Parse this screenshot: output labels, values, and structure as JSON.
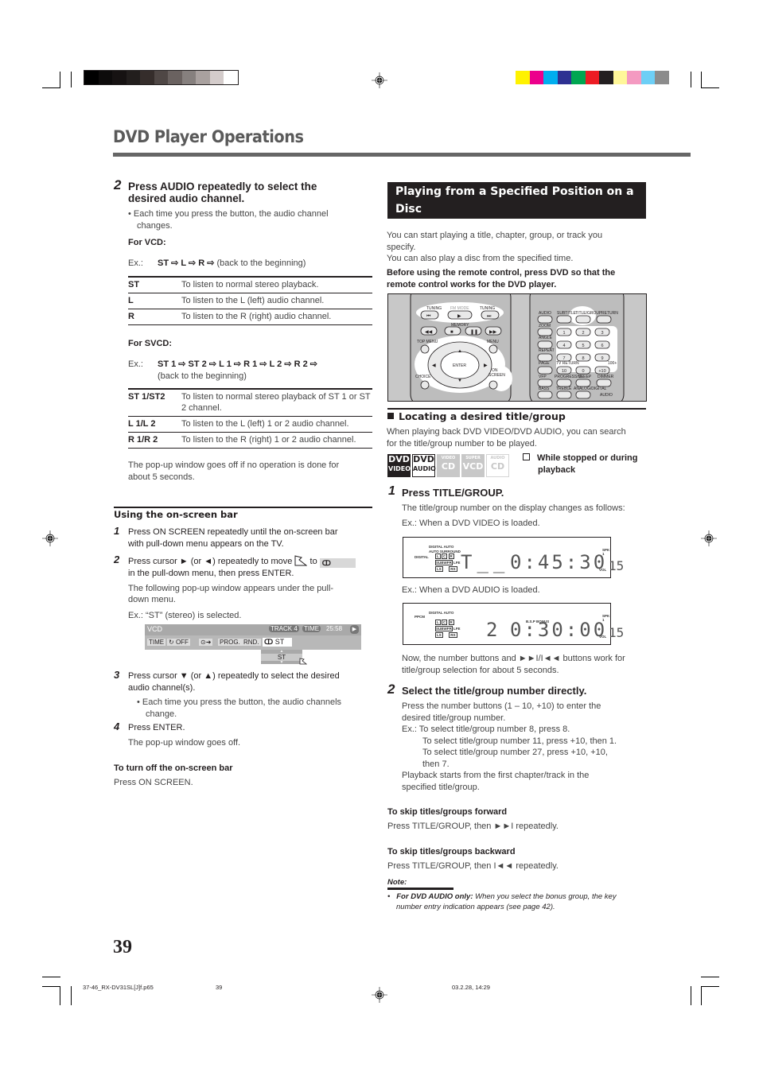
{
  "header": {
    "title": "DVD Player Operations",
    "gray_swatches": [
      "#000000",
      "#0d0b0b",
      "#161212",
      "#221e1d",
      "#352d2b",
      "#4f4745",
      "#6a6260",
      "#86807e",
      "#a9a19f",
      "#d4cccb",
      "#ffffff"
    ],
    "color_swatches": [
      "#fff200",
      "#ec008c",
      "#00aeef",
      "#2e3192",
      "#00a651",
      "#ed1c24",
      "#231f20",
      "#fff799",
      "#f49ac1",
      "#6dcff6",
      "#8c8c8c"
    ]
  },
  "left": {
    "step2": {
      "num": "2",
      "heading_line1": "Press AUDIO repeatedly to select the",
      "heading_line2": "desired audio channel.",
      "bullet_line1": "• Each time you press the button, the audio channel",
      "bullet_line2": "changes."
    },
    "vcd": {
      "label": "For VCD:",
      "ex_prefix": "Ex.:",
      "sequence": "ST ⇨ L ⇨ R ⇨",
      "sequence_tail": "(back to the beginning)",
      "rows": [
        {
          "key": "ST",
          "desc": "To listen to normal stereo playback."
        },
        {
          "key": "L",
          "desc": "To listen to the L (left) audio channel."
        },
        {
          "key": "R",
          "desc": "To listen to the R (right) audio channel."
        }
      ]
    },
    "svcd": {
      "label": "For SVCD:",
      "ex_prefix": "Ex.:",
      "sequence": "ST 1 ⇨ ST 2 ⇨ L 1 ⇨ R 1 ⇨ L 2 ⇨ R 2 ⇨",
      "sequence_tail": "(back to the beginning)",
      "rows": [
        {
          "key": "ST 1/ST2",
          "desc": "To listen to normal stereo playback of ST 1 or ST 2 channel."
        },
        {
          "key": "L 1/L 2",
          "desc": "To listen to the L (left) 1 or 2 audio channel."
        },
        {
          "key": "R 1/R 2",
          "desc": "To listen to the R (right) 1 or 2 audio channel."
        }
      ]
    },
    "popup_note_line1": "The pop-up window goes off if no operation is done for",
    "popup_note_line2": "about 5 seconds.",
    "onscreen": {
      "heading": "Using the on-screen bar",
      "s1_num": "1",
      "s1_line1": "Press ON SCREEN repeatedly until the on-screen bar",
      "s1_line2": "with pull-down menu appears on the TV.",
      "s2_num": "2",
      "s2_line1a": "Press cursor ► (or ◄) repeatedly to move",
      "s2_line1b": "to",
      "s2_line2": "in the pull-down menu, then press ENTER.",
      "s2_sub1": "The following pop-up window appears under the pull-",
      "s2_sub2": "down menu.",
      "s2_ex": "Ex.:  “ST” (stereo) is selected.",
      "osd": {
        "source": "VCD",
        "track": "TRACK 4",
        "time_label": "TIME",
        "time_value": "25:58",
        "menu": [
          "TIME",
          "OFF",
          "PROG.",
          "RND."
        ],
        "audio_value": "ST",
        "popup_value": "ST"
      },
      "s3_num": "3",
      "s3_line1": "Press cursor ▼ (or ▲) repeatedly to select the desired",
      "s3_line2": "audio channel(s).",
      "s3_bullet1": "• Each time you press the button, the audio channels",
      "s3_bullet2": "change.",
      "s4_num": "4",
      "s4_line": "Press ENTER.",
      "s4_sub": "The pop-up window goes off.",
      "off_heading": "To turn off the on-screen bar",
      "off_text": "Press ON SCREEN."
    }
  },
  "right": {
    "section_title": "Playing from a Specified Position on a Disc",
    "intro1_line1": "You can start playing a title, chapter, group, or track you",
    "intro1_line2": "specify.",
    "intro2": "You can also play a disc from the specified time.",
    "warn_line1": "Before using the remote control, press DVD so that the",
    "warn_line2": "remote control works for the DVD player.",
    "remote": {
      "left_labels": [
        "TUNING",
        "FM MODE",
        "TUNING",
        "MEMORY",
        "TOP MENU",
        "MENU",
        "ENTER",
        "CHOICE",
        "ON SCREEN"
      ],
      "right_labels": [
        "AUDIO",
        "SUBTITLE",
        "TITLE/GROUP",
        "RETURN",
        "ZOOM",
        "ANGLE",
        "REPEAT",
        "PAGE",
        "TV RETURN",
        "100+",
        "VFP",
        "PROGRESSIVE",
        "SLEEP",
        "DIMMER",
        "BASS",
        "TREBLE",
        "ANALOG/DIGITAL",
        "INPUT",
        "AUDIO"
      ],
      "number_keys": [
        "1",
        "2",
        "3",
        "4",
        "5",
        "6",
        "7",
        "8",
        "9",
        "10",
        "0",
        "+10"
      ]
    },
    "locating": {
      "heading": "Locating a desired title/group",
      "desc_line1": "When playing back DVD VIDEO/DVD AUDIO, you can search",
      "desc_line2": "for the title/group number to be played.",
      "badges": [
        {
          "top": "DVD",
          "bottom": "VIDEO",
          "state": "active-filled"
        },
        {
          "top": "DVD",
          "bottom": "AUDIO",
          "state": "active-outline"
        },
        {
          "top": "VIDEO",
          "bottom": "CD",
          "state": "inactive"
        },
        {
          "top": "SUPER",
          "bottom": "VCD",
          "state": "inactive"
        },
        {
          "top": "AUDIO",
          "bottom": "CD",
          "state": "inactive-outline"
        }
      ],
      "condition_line1": "While stopped or during",
      "condition_line2": "playback"
    },
    "step1": {
      "num": "1",
      "heading": "Press TITLE/GROUP.",
      "desc": "The title/group number on the display changes as follows:",
      "ex1": "Ex.:  When a DVD VIDEO is loaded.",
      "lcd1": {
        "indicators": [
          "DIGITAL AUTO",
          "AUTO SURROUND",
          "DIGITAL",
          "L",
          "C",
          "R",
          "SUBWFR",
          "LFE",
          "LS",
          "RS",
          "SPK 1",
          "VOL"
        ],
        "main": "T__",
        "time": "0:45:30",
        "vol": "15"
      },
      "ex2": "Ex.:  When a DVD AUDIO is loaded.",
      "lcd2": {
        "indicators": [
          "PPCM",
          "DIGITAL AUTO",
          "L",
          "C",
          "R",
          "SUBWFR",
          "LFE",
          "LS",
          "RS",
          "B.S.P",
          "BONUS",
          "SPK 1",
          "VOL"
        ],
        "main": "2",
        "time": "0:30:00",
        "vol": "15"
      },
      "after_line1": "Now, the number buttons and ►►I/I◄◄ buttons work for",
      "after_line2": "title/group selection for about 5 seconds."
    },
    "step2": {
      "num": "2",
      "heading": "Select the title/group number directly.",
      "l1": "Press the number buttons (1 – 10, +10) to enter the",
      "l2": "desired title/group number.",
      "l3": "Ex.:  To select title/group number 8, press 8.",
      "l4": "To select title/group number 11, press +10, then 1.",
      "l5": "To select title/group number 27, press +10, +10,",
      "l6": "then 7.",
      "l7": "Playback starts from the first chapter/track in the",
      "l8": "specified title/group."
    },
    "skip_fwd": {
      "heading": "To skip titles/groups forward",
      "text": "Press TITLE/GROUP, then ►►I repeatedly."
    },
    "skip_back": {
      "heading": "To skip titles/groups backward",
      "text": "Press TITLE/GROUP, then I◄◄ repeatedly."
    },
    "note": {
      "label": "Note:",
      "bold": "For DVD AUDIO only:",
      "text1": " When you select the bonus group, the key",
      "text2": "number entry indication appears (see page 42)."
    }
  },
  "footer": {
    "page_number": "39",
    "file_name": "37-46_RX-DV31SL[J]f.p65",
    "file_page": "39",
    "timestamp": "03.2.28, 14:29"
  }
}
